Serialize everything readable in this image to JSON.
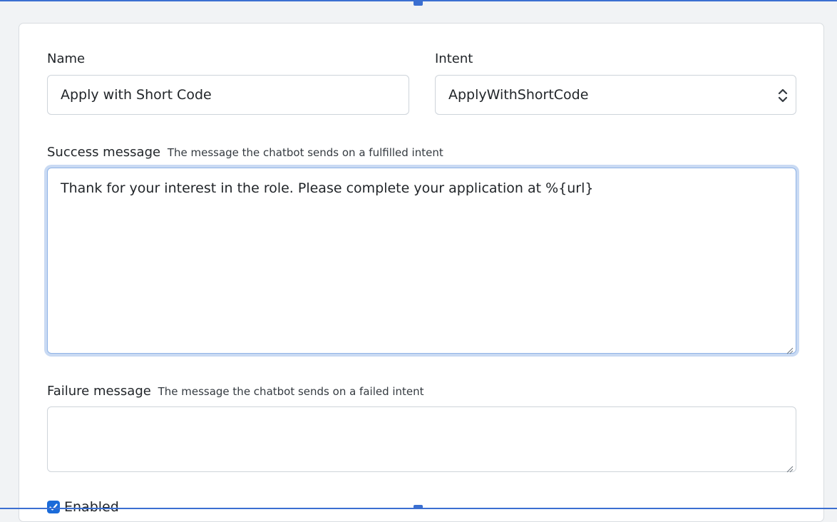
{
  "form": {
    "name": {
      "label": "Name",
      "value": "Apply with Short Code"
    },
    "intent": {
      "label": "Intent",
      "selected": "ApplyWithShortCode"
    },
    "success_message": {
      "label": "Success message",
      "hint": "The message the chatbot sends on a fulfilled intent",
      "value": "Thank for your interest in the role. Please complete your application at %{url}"
    },
    "failure_message": {
      "label": "Failure message",
      "hint": "The message the chatbot sends on a failed intent",
      "value": ""
    },
    "enabled": {
      "label": "Enabled",
      "checked": true
    }
  },
  "icons": {
    "select_chevrons": "chevron-up-down-icon",
    "checkbox": "check-icon",
    "resize": "resize-grip-icon"
  },
  "colors": {
    "accent": "#1b6bd9",
    "focus_ring": "#c9daf3",
    "frame_line": "#3b6fd1",
    "border": "#ced4da",
    "background": "#f1f3f5"
  }
}
